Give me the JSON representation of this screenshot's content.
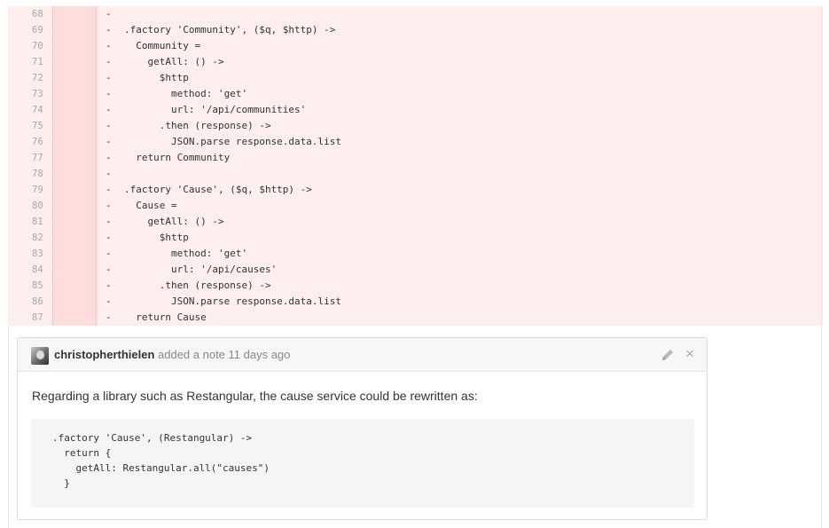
{
  "diff": {
    "lines": [
      {
        "number": "68",
        "marker": "-",
        "code": ""
      },
      {
        "number": "69",
        "marker": "-",
        "code": ".factory 'Community', ($q, $http) ->"
      },
      {
        "number": "70",
        "marker": "-",
        "code": "  Community ="
      },
      {
        "number": "71",
        "marker": "-",
        "code": "    getAll: () ->"
      },
      {
        "number": "72",
        "marker": "-",
        "code": "      $http"
      },
      {
        "number": "73",
        "marker": "-",
        "code": "        method: 'get'"
      },
      {
        "number": "74",
        "marker": "-",
        "code": "        url: '/api/communities'"
      },
      {
        "number": "75",
        "marker": "-",
        "code": "      .then (response) ->"
      },
      {
        "number": "76",
        "marker": "-",
        "code": "        JSON.parse response.data.list"
      },
      {
        "number": "77",
        "marker": "-",
        "code": "  return Community"
      },
      {
        "number": "78",
        "marker": "-",
        "code": ""
      },
      {
        "number": "79",
        "marker": "-",
        "code": ".factory 'Cause', ($q, $http) ->"
      },
      {
        "number": "80",
        "marker": "-",
        "code": "  Cause ="
      },
      {
        "number": "81",
        "marker": "-",
        "code": "    getAll: () ->"
      },
      {
        "number": "82",
        "marker": "-",
        "code": "      $http"
      },
      {
        "number": "83",
        "marker": "-",
        "code": "        method: 'get'"
      },
      {
        "number": "84",
        "marker": "-",
        "code": "        url: '/api/causes'"
      },
      {
        "number": "85",
        "marker": "-",
        "code": "      .then (response) ->"
      },
      {
        "number": "86",
        "marker": "-",
        "code": "        JSON.parse response.data.list"
      },
      {
        "number": "87",
        "marker": "-",
        "code": "  return Cause"
      }
    ]
  },
  "note": {
    "author": "christopherthielen",
    "meta": "added a note 11 days ago",
    "body": "Regarding a library such as Restangular, the cause service could be rewritten as:",
    "code": ".factory 'Cause', (Restangular) ->\n  return {\n    getAll: Restangular.all(\"causes\")\n  }",
    "edit_icon": "pencil-icon",
    "close_icon": "close-icon",
    "close_glyph": "×"
  },
  "colors": {
    "deleted_bg": "#ffeeee",
    "deleted_gutter": "#ffdddd"
  }
}
